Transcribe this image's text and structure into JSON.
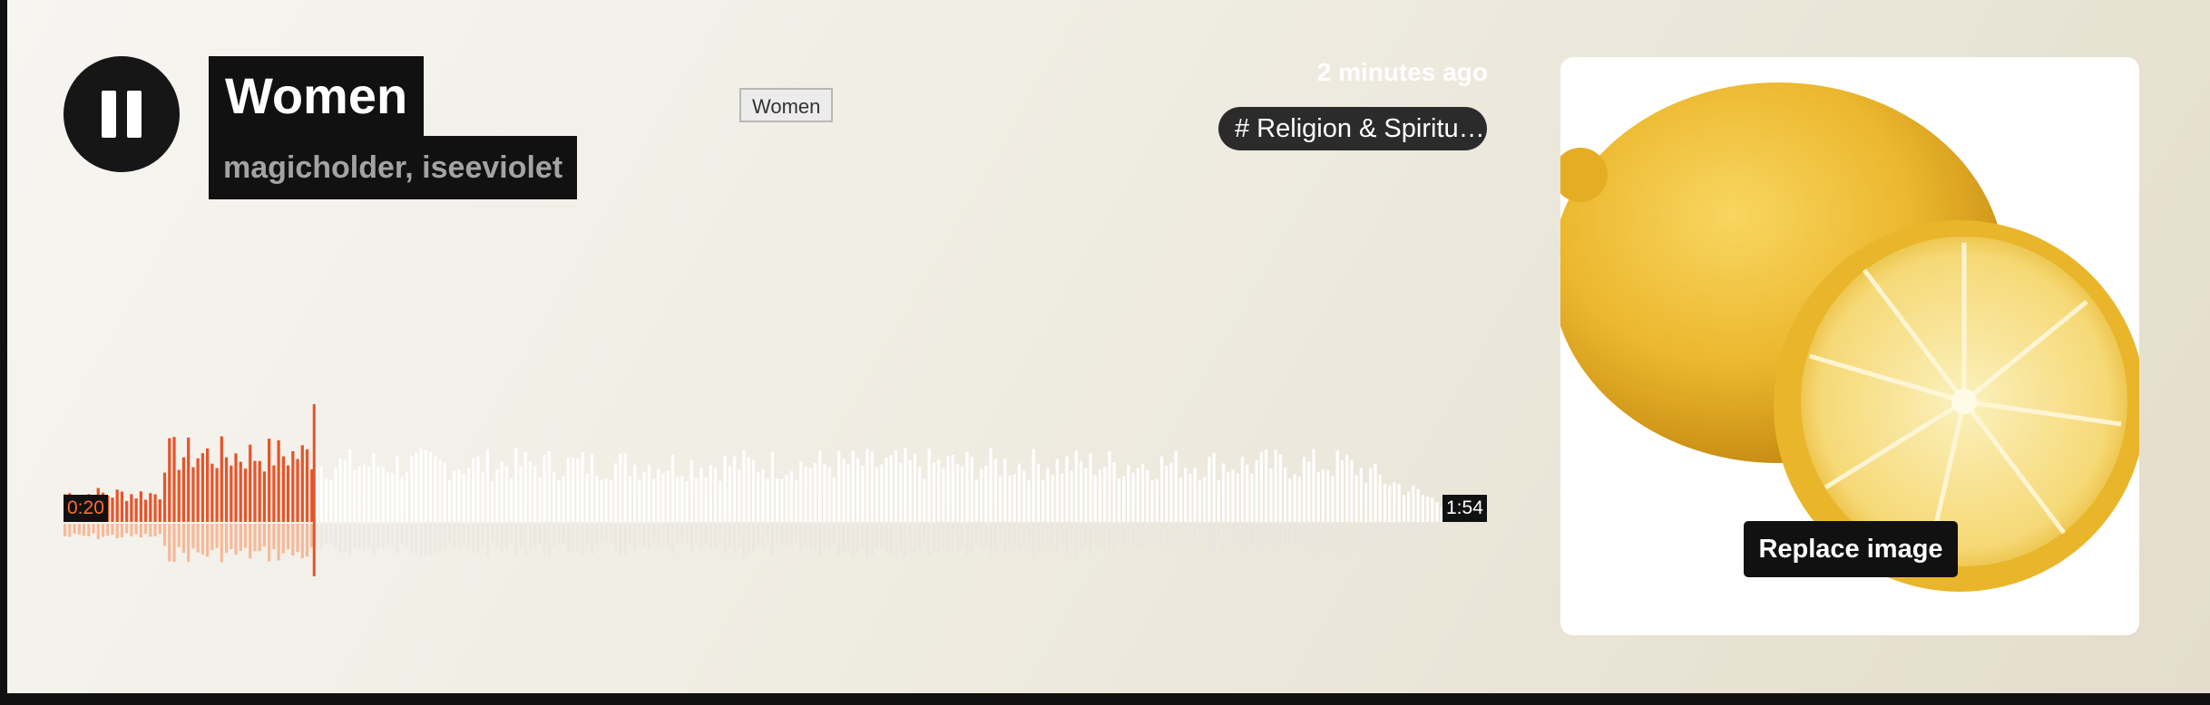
{
  "track": {
    "title": "Women",
    "artists": "magicholder, iseeviolet",
    "tooltip": "Women",
    "posted": "2 minutes ago",
    "tag": "# Religion & Spiritu…"
  },
  "player": {
    "state": "playing",
    "current_time": "0:20",
    "duration": "1:54",
    "progress": 0.175,
    "played_color": "#e8542a",
    "unplayed_color": "#ffffff"
  },
  "artwork": {
    "subject": "lemon-image",
    "replace_label": "Replace image"
  }
}
